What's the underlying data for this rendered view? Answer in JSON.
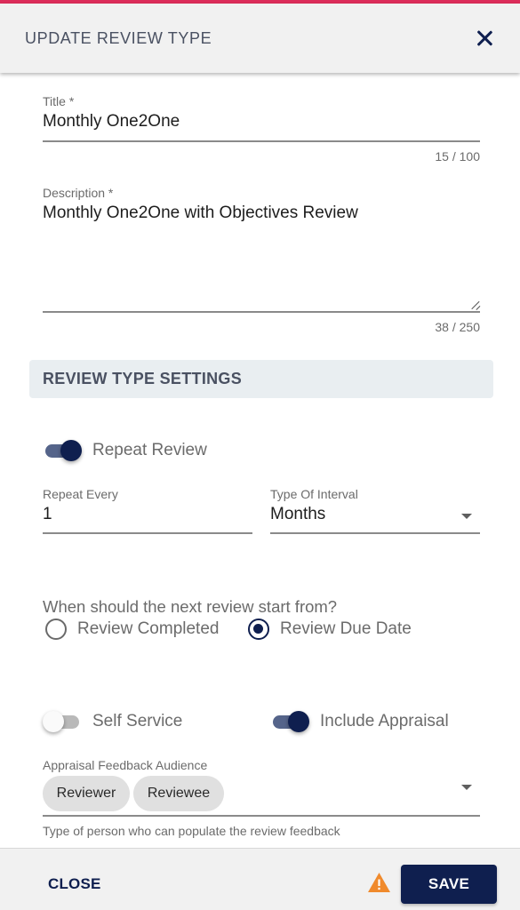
{
  "header": {
    "title": "UPDATE REVIEW TYPE",
    "close_icon": "close-icon"
  },
  "form": {
    "title_field": {
      "label": "Title *",
      "value": "Monthly One2One",
      "counter": "15 / 100"
    },
    "description_field": {
      "label": "Description *",
      "value": "Monthly One2One with Objectives Review",
      "counter": "38 / 250"
    },
    "section_title": "REVIEW TYPE SETTINGS",
    "repeat_review": {
      "label": "Repeat Review",
      "checked": true
    },
    "repeat_every": {
      "label": "Repeat Every",
      "value": "1"
    },
    "interval_type": {
      "label": "Type Of Interval",
      "value": "Months"
    },
    "next_review_question": "When should the next review start from?",
    "next_review_options": [
      {
        "label": "Review Completed",
        "selected": false
      },
      {
        "label": "Review Due Date",
        "selected": true
      }
    ],
    "self_service": {
      "label": "Self Service",
      "checked": false
    },
    "include_appraisal": {
      "label": "Include Appraisal",
      "checked": true
    },
    "appraisal_audience": {
      "label": "Appraisal Feedback Audience",
      "chips": [
        "Reviewer",
        "Reviewee"
      ],
      "hint": "Type of person who can populate the review feedback"
    }
  },
  "footer": {
    "close_label": "CLOSE",
    "warning_icon": "warning-icon",
    "save_label": "SAVE"
  },
  "colors": {
    "accent_bar": "#dc2c5a",
    "primary": "#0f1f4f",
    "warning": "#f08a2c"
  }
}
